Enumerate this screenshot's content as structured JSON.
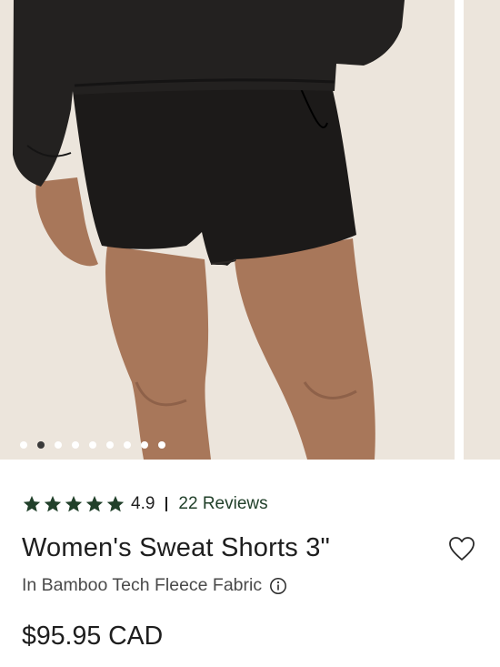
{
  "gallery": {
    "image_alt": "Model wearing black sweat shorts",
    "slide_count": 9,
    "active_index": 1
  },
  "rating": {
    "stars": 5,
    "value": "4.9",
    "reviews_label": "22 Reviews",
    "star_color": "#21402a"
  },
  "product": {
    "title": "Women's Sweat Shorts 3\"",
    "subtitle": "In Bamboo Tech Fleece Fabric",
    "price": "$95.95 CAD"
  },
  "icons": {
    "wishlist": "heart-icon",
    "info": "info-icon",
    "star": "star-icon"
  }
}
